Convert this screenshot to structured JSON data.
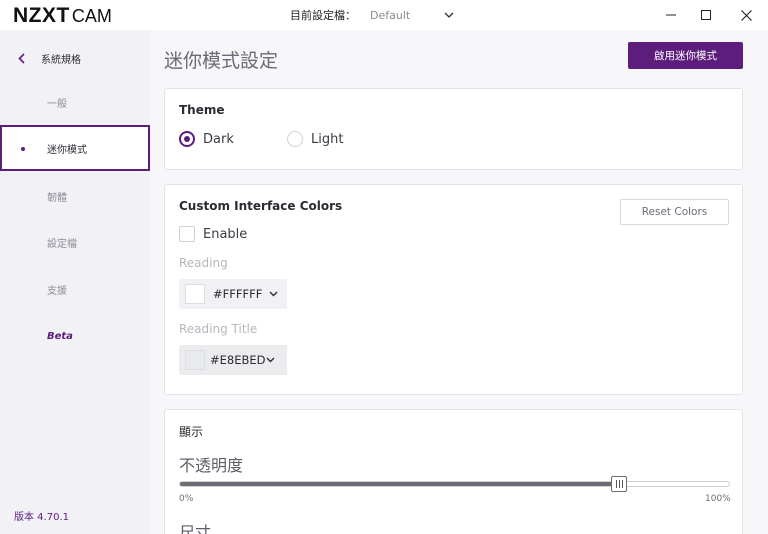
{
  "app": {
    "logo_main": "NZXT",
    "logo_sub": "CAM",
    "profile_label": "目前設定檔：",
    "profile_value": "Default"
  },
  "sidebar": {
    "back_label": "系統規格",
    "items": [
      {
        "label": "一般"
      },
      {
        "label": "迷你模式"
      },
      {
        "label": "韌體"
      },
      {
        "label": "設定檔"
      },
      {
        "label": "支援"
      },
      {
        "label": "Beta"
      }
    ],
    "version": "版本 4.70.1"
  },
  "main": {
    "title": "迷你模式設定",
    "enable_button": "啟用迷你模式",
    "theme": {
      "title": "Theme",
      "options": [
        {
          "label": "Dark",
          "checked": true
        },
        {
          "label": "Light",
          "checked": false
        }
      ]
    },
    "colors": {
      "title": "Custom Interface Colors",
      "reset_button": "Reset Colors",
      "enable_label": "Enable",
      "enabled": false,
      "reading_label": "Reading",
      "reading_value": "#FFFFFF",
      "reading_title_label": "Reading Title",
      "reading_title_value": "#E8EBED"
    },
    "display": {
      "title": "顯示",
      "opacity_label": "不透明度",
      "opacity_value": 0.8,
      "min_label": "0%",
      "max_label": "100%",
      "size_label": "尺寸"
    }
  },
  "colors": {
    "accent": "#5C1D7D",
    "reading_swatch": "#FFFFFF",
    "reading_title_swatch": "#E8EBED"
  }
}
